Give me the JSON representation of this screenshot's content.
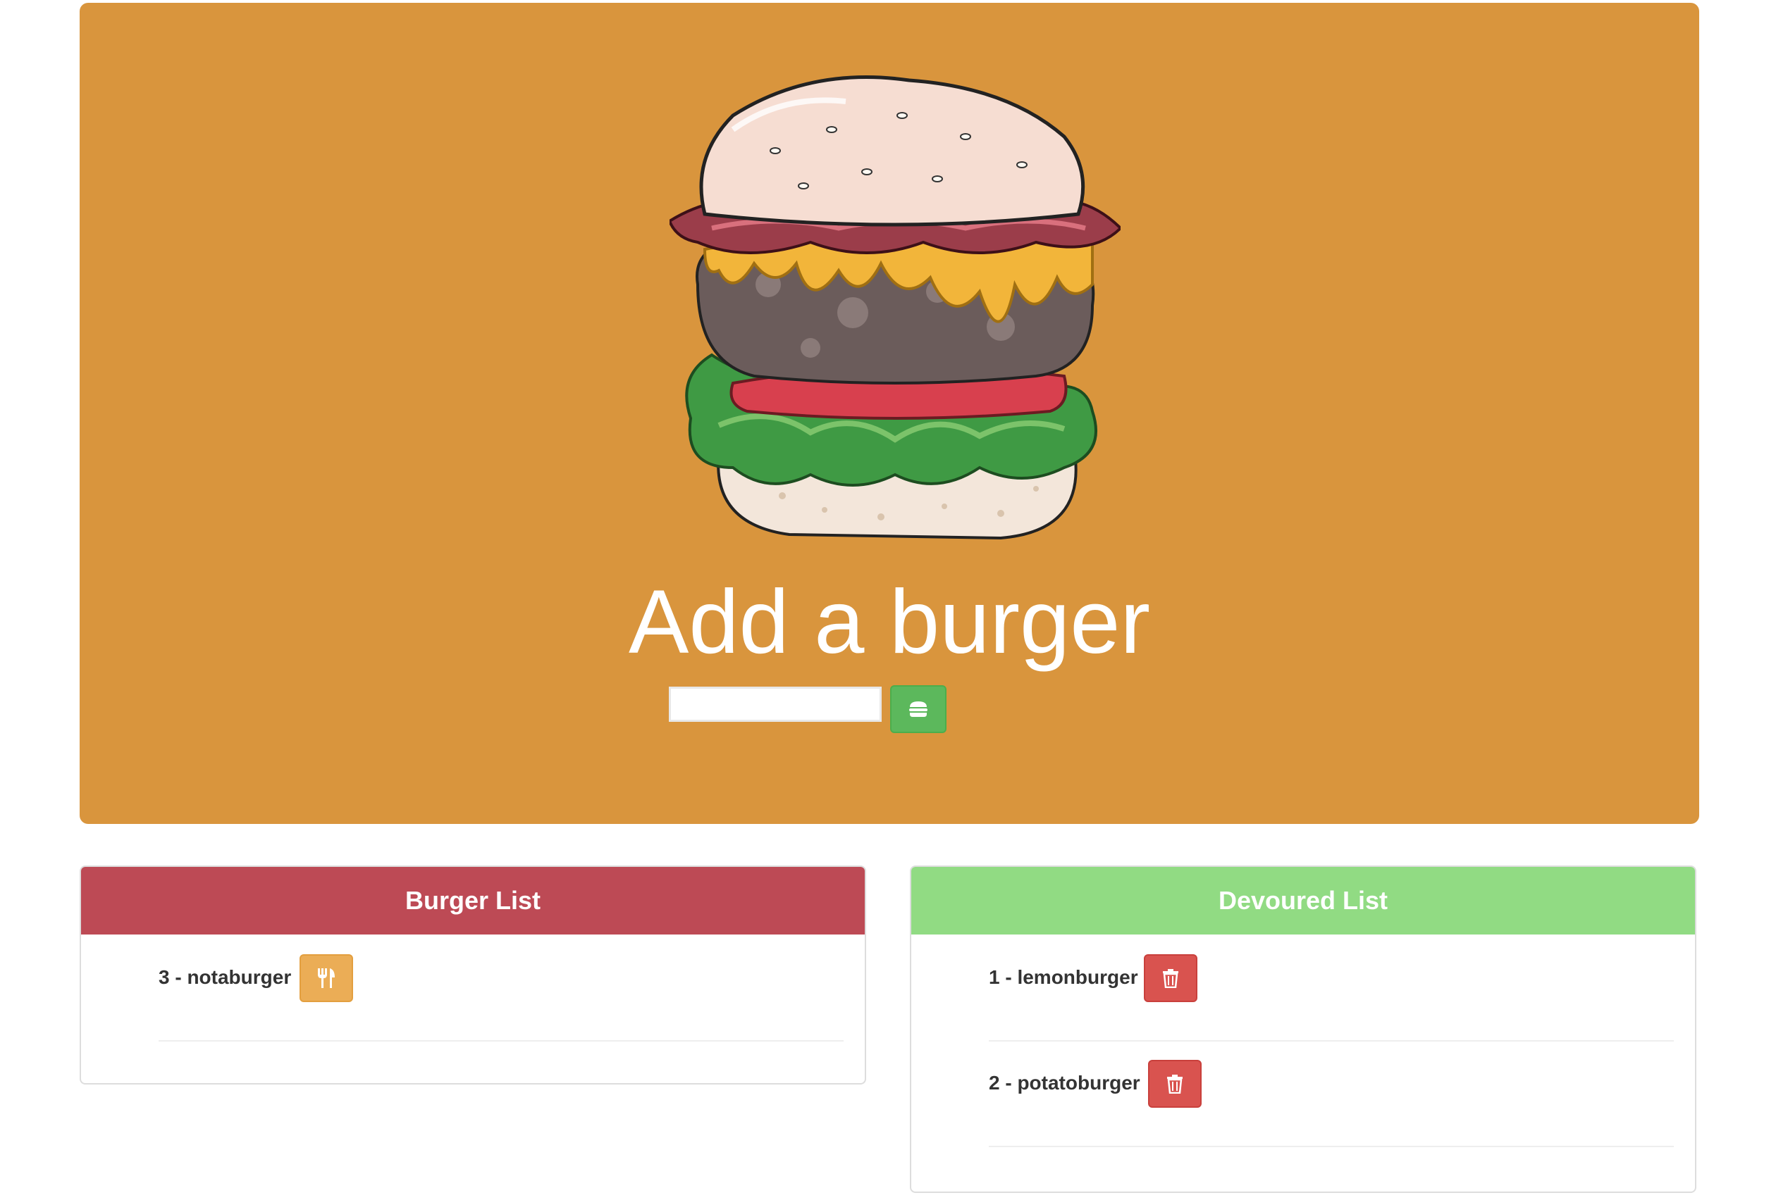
{
  "hero": {
    "title": "Add a burger",
    "input_value": "",
    "input_placeholder": "",
    "submit_icon": "burger-icon",
    "background_color": "#D9953D"
  },
  "burger_list": {
    "title": "Burger List",
    "header_color": "#BD4A55",
    "items": [
      {
        "label": "3 - notaburger",
        "action_icon": "utensils-icon"
      }
    ]
  },
  "devoured_list": {
    "title": "Devoured List",
    "header_color": "#91DB83",
    "items": [
      {
        "label": "1 - lemonburger",
        "action_icon": "trash-icon"
      },
      {
        "label": "2 - potatoburger",
        "action_icon": "trash-icon"
      }
    ]
  }
}
